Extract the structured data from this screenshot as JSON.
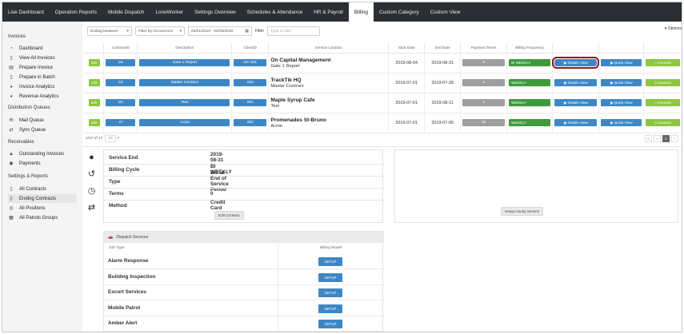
{
  "topnav": {
    "tabs": [
      {
        "label": "Live Dashboard",
        "active": false
      },
      {
        "label": "Operation Reports",
        "active": false
      },
      {
        "label": "Mobile Dispatch",
        "active": false
      },
      {
        "label": "LoneWorker",
        "active": false
      },
      {
        "label": "Settings Overview",
        "active": false
      },
      {
        "label": "Schedules & Attendance",
        "active": false
      },
      {
        "label": "HR & Payroll",
        "active": false
      },
      {
        "label": "Billing",
        "active": true
      },
      {
        "label": "Custom Category",
        "active": false
      },
      {
        "label": "Custom View",
        "active": false
      }
    ]
  },
  "sidebar": {
    "sections": [
      {
        "title": "Invoices",
        "items": [
          "Dashboard",
          "View All Invoices",
          "Prepare Invoice",
          "Prepare in Batch",
          "Invoice Analytics",
          "Revenue Analytics"
        ]
      },
      {
        "title": "Distribution Queues",
        "items": [
          "Mail Queue",
          "Sync Queue"
        ]
      },
      {
        "title": "Receivables",
        "items": [
          "Outstanding Invoices",
          "Payments"
        ]
      },
      {
        "title": "Settings & Reports",
        "items": [
          "All Contracts",
          "Ending Contracts",
          "All Positions",
          "All Patrols Groups"
        ]
      }
    ]
  },
  "filters": {
    "ending_between": "Ending between",
    "occurrence": "Filter by Occurrence",
    "date_range": "02/01/2019 - 02/29/2020",
    "filter_label": "Filter",
    "filter_placeholder": "Type to filter",
    "options": "Options"
  },
  "table": {
    "headers": [
      "",
      "ContractID",
      "Description",
      "ClientID",
      "Service Location",
      "Start Date",
      "End Date",
      "Payment Terms",
      "Billing Frequency",
      "",
      "",
      ""
    ],
    "edit_label": "Edit",
    "details_label": "Details View",
    "quick_label": "Quick View",
    "invoices_label": "Invoices",
    "rows": [
      {
        "contract": "54",
        "description": "Gate 1 Report",
        "client": "OC-001",
        "loc_name": "On Capital Management",
        "loc_sub": "Gate 1 Report",
        "start": "2019-08-04",
        "end": "2019-08-31",
        "terms": "0",
        "freq": "BI WEEKLY"
      },
      {
        "contract": "53",
        "description": "Master Contract",
        "client": "010",
        "loc_name": "TrackTik HQ",
        "loc_sub": "Master Contract",
        "start": "2019-07-01",
        "end": "2019-07-28",
        "terms": "0",
        "freq": "WEEKLY"
      },
      {
        "contract": "50",
        "description": "Test",
        "client": "001",
        "loc_name": "Maple Syrup Cafe",
        "loc_sub": "Test",
        "start": "2019-07-01",
        "end": "2019-08-11",
        "terms": "0",
        "freq": "WEEKLY"
      },
      {
        "contract": "47",
        "description": "Acme",
        "client": "004",
        "loc_name": "Promenades St-Bruno",
        "loc_sub": "Acme",
        "start": "2019-07-01",
        "end": "2019-07-05",
        "terms": "30",
        "freq": "WEEKLY"
      }
    ]
  },
  "pager": {
    "summary": "1/17 of 17",
    "per_page": "25",
    "current": "1"
  },
  "detail": {
    "rows": [
      {
        "label": "Service End",
        "value": "2019-08-31"
      },
      {
        "label": "Billing Cycle",
        "value": "BI WEEKLY"
      },
      {
        "label": "Type",
        "value": "Bill at End of Service Period"
      },
      {
        "label": "Terms",
        "value": "0"
      },
      {
        "label": "Method",
        "value": "Credit Card"
      }
    ],
    "edit_button": "Edit Contract",
    "setup_hourly": "Setup Hourly Service"
  },
  "dispatch": {
    "title": "Dispatch Services",
    "col_job": "Job Type",
    "col_model": "Billing Model",
    "setup_label": "SETUP",
    "jobs": [
      "Alarm Response",
      "Building Inspection",
      "Escort Services",
      "Mobile Patrol",
      "Amber Alert"
    ]
  },
  "colors": {
    "nav": "#2b2f33",
    "blue": "#3d86c6",
    "green": "#8dc63f",
    "dark_green": "#3f9a3c",
    "grey": "#9e9e9e",
    "highlight": "#8b1a1a"
  }
}
